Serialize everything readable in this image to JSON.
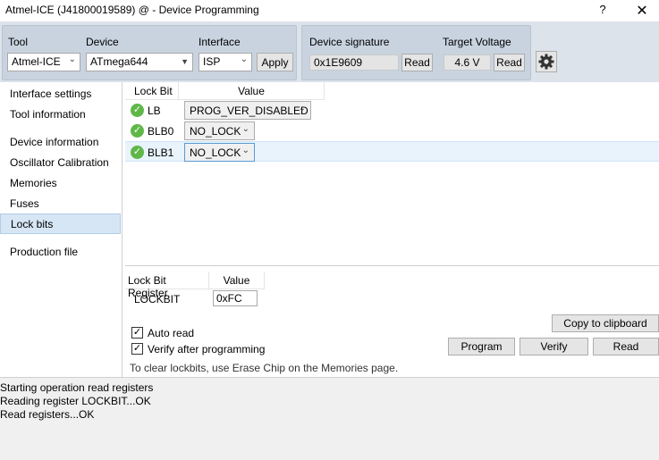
{
  "window": {
    "title": "Atmel-ICE (J41800019589) @  - Device Programming",
    "help_label": "?",
    "close_label": "✕"
  },
  "toolbar": {
    "tool_label": "Tool",
    "tool_value": "Atmel-ICE",
    "device_label": "Device",
    "device_value": "ATmega644",
    "interface_label": "Interface",
    "interface_value": "ISP",
    "apply_label": "Apply",
    "signature_label": "Device signature",
    "signature_value": "0x1E9609",
    "signature_read_label": "Read",
    "voltage_label": "Target Voltage",
    "voltage_value": "4.6 V",
    "voltage_read_label": "Read",
    "settings_icon": "gear-icon"
  },
  "sidebar": {
    "items": [
      {
        "label": "Interface settings"
      },
      {
        "label": "Tool information"
      },
      {
        "label": "Device information"
      },
      {
        "label": "Oscillator Calibration"
      },
      {
        "label": "Memories"
      },
      {
        "label": "Fuses"
      },
      {
        "label": "Lock bits"
      },
      {
        "label": "Production file"
      }
    ],
    "active": "Lock bits"
  },
  "lockbits": {
    "col_lockbit": "Lock Bit",
    "col_value": "Value",
    "rows": [
      {
        "name": "LB",
        "value": "PROG_VER_DISABLED",
        "status_icon": "check-icon"
      },
      {
        "name": "BLB0",
        "value": "NO_LOCK",
        "status_icon": "check-icon"
      },
      {
        "name": "BLB1",
        "value": "NO_LOCK",
        "status_icon": "check-icon"
      }
    ]
  },
  "register": {
    "col_register": "Lock Bit Register",
    "col_value": "Value",
    "name": "LOCKBIT",
    "value": "0xFC"
  },
  "controls": {
    "copy_label": "Copy to clipboard",
    "auto_read_label": "Auto read",
    "auto_read_checked": true,
    "verify_label": "Verify after programming",
    "verify_checked": true,
    "check_mark": "✓",
    "program_label": "Program",
    "verify_button_label": "Verify",
    "read_label": "Read",
    "hint": "To clear lockbits, use Erase Chip on the Memories page."
  },
  "log": {
    "lines": [
      "Starting operation read registers",
      "Reading register LOCKBIT...OK",
      "Read registers...OK"
    ]
  }
}
